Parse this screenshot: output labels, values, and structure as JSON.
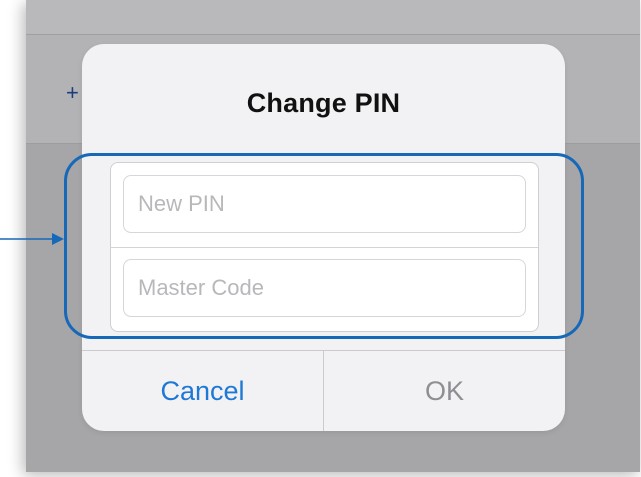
{
  "background_app": {
    "add_icon": "plus-icon"
  },
  "dialog": {
    "title": "Change PIN",
    "fields": [
      {
        "placeholder": "New PIN",
        "value": ""
      },
      {
        "placeholder": "Master Code",
        "value": ""
      }
    ],
    "buttons": {
      "cancel_label": "Cancel",
      "ok_label": "OK"
    }
  },
  "annotation": {
    "highlight_color": "#1668b8",
    "icon": "arrow-right-icon"
  },
  "colors": {
    "accent": "#1e78d6",
    "disabled": "#8e8e93"
  }
}
